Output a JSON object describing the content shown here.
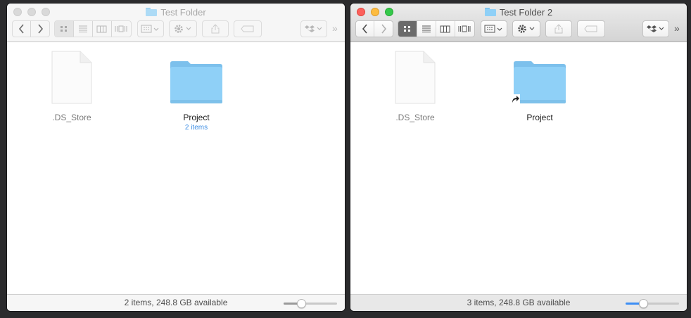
{
  "windows": [
    {
      "title": "Test Folder",
      "state": "inactive",
      "items": [
        {
          "name": ".DS_Store",
          "kind": "document",
          "detail": ""
        },
        {
          "name": "Project",
          "kind": "folder",
          "detail": "2 items"
        }
      ],
      "status": "2 items, 248.8 GB available",
      "icon_size_fraction": 0.33
    },
    {
      "title": "Test Folder 2",
      "state": "active",
      "items": [
        {
          "name": ".DS_Store",
          "kind": "document",
          "detail": ""
        },
        {
          "name": "Project",
          "kind": "folder-alias",
          "detail": ""
        }
      ],
      "status": "3 items, 248.8 GB available",
      "icon_size_fraction": 0.33
    }
  ],
  "toolbar": {
    "icons": [
      "back-icon",
      "forward-icon",
      "icon-view-icon",
      "list-view-icon",
      "column-view-icon",
      "cover-flow-icon",
      "arrange-icon",
      "action-gear-icon",
      "share-icon",
      "tags-icon",
      "dropbox-icon",
      "overflow-icon"
    ],
    "overflow_label": "»"
  },
  "colors": {
    "folder": "#8fd0f7",
    "close": "#fc605c",
    "minimize": "#fdbc40",
    "zoom": "#34c84a",
    "selected_segment_active": "#6b6b6b",
    "slider_fill_active": "#3d8ef5"
  }
}
